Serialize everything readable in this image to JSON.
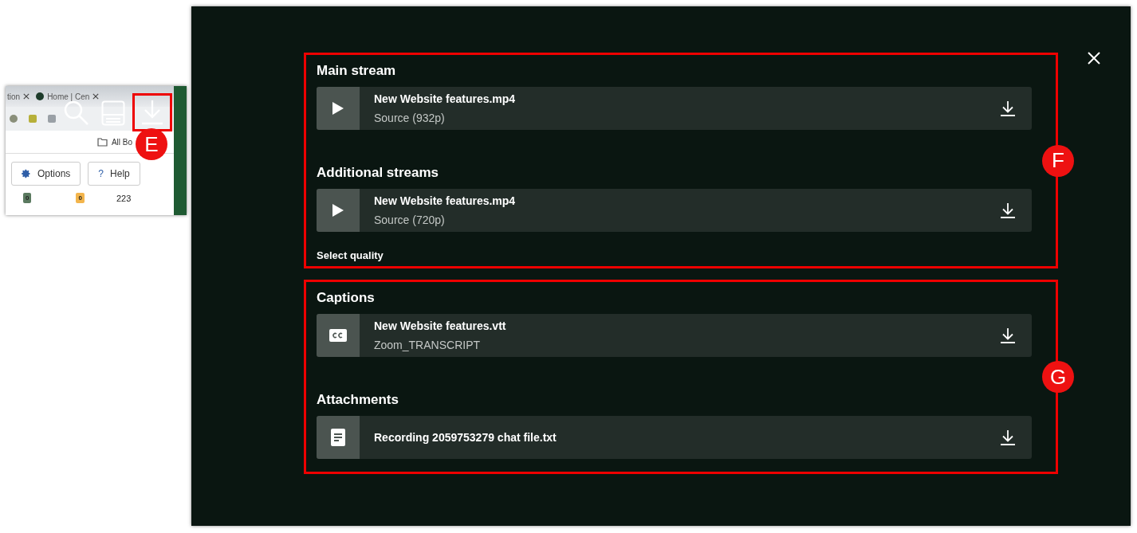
{
  "inset": {
    "tabs": [
      {
        "label": "tion"
      },
      {
        "label": "Home | Cen"
      }
    ],
    "bookmarks_label": "All Bo",
    "buttons": [
      {
        "label": "Options",
        "kind": "settings"
      },
      {
        "label": "Help",
        "kind": "help",
        "glyph": "?"
      }
    ],
    "counts": [
      {
        "value": "0",
        "color": "#5b7a60"
      },
      {
        "value": "0",
        "color": "#f3b54c"
      },
      {
        "value": "223"
      }
    ],
    "callout": "E"
  },
  "groups": [
    {
      "callout": "F",
      "footer": "Select quality",
      "sections": [
        {
          "heading": "Main stream",
          "items": [
            {
              "kind": "video",
              "title": "New Website features.mp4",
              "subtitle": "Source (932p)"
            }
          ]
        },
        {
          "heading": "Additional streams",
          "items": [
            {
              "kind": "video",
              "title": "New Website features.mp4",
              "subtitle": "Source (720p)"
            }
          ]
        }
      ]
    },
    {
      "callout": "G",
      "sections": [
        {
          "heading": "Captions",
          "items": [
            {
              "kind": "captions",
              "title": "New Website features.vtt",
              "subtitle": "Zoom_TRANSCRIPT"
            }
          ]
        },
        {
          "heading": "Attachments",
          "items": [
            {
              "kind": "document",
              "title": "Recording 2059753279 chat file.txt"
            }
          ]
        }
      ]
    }
  ]
}
